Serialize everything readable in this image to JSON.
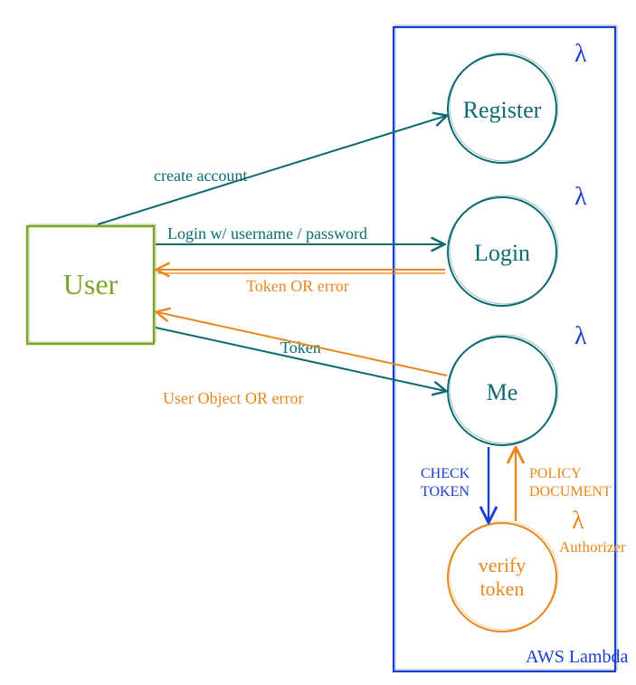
{
  "colors": {
    "green": "#7BA428",
    "teal": "#0D6A72",
    "orange": "#E8871E",
    "blue": "#1A3FCC"
  },
  "user": {
    "label": "User"
  },
  "container": {
    "label": "AWS Lambda"
  },
  "lambdas": {
    "register": {
      "label": "Register",
      "symbol": "λ"
    },
    "login": {
      "label": "Login",
      "symbol": "λ"
    },
    "me": {
      "label": "Me",
      "symbol": "λ"
    },
    "verify": {
      "label": "verify\ntoken",
      "symbol": "λ",
      "role": "Authorizer"
    }
  },
  "arrows": {
    "create_account": "create account",
    "login_req": "Login w/ username / password",
    "login_res": "Token OR error",
    "me_req": "Token",
    "me_res": "User Object OR error",
    "check_token": "CHECK\nTOKEN",
    "policy_doc": "POLICY\nDOCUMENT"
  }
}
